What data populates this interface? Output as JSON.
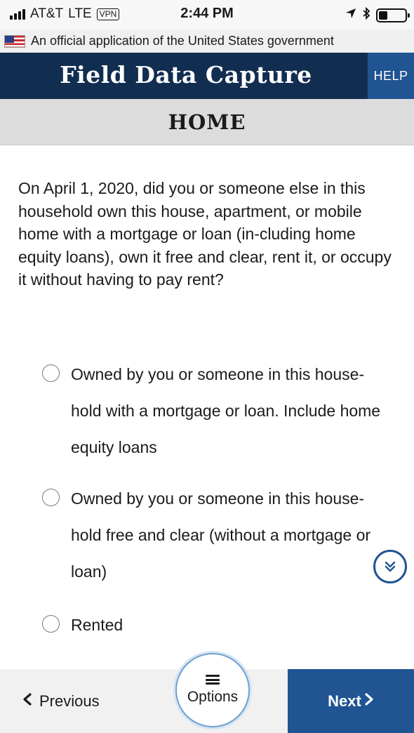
{
  "status_bar": {
    "carrier": "AT&T",
    "network": "LTE",
    "vpn": "VPN",
    "time": "2:44 PM",
    "location_icon": "location-arrow-icon",
    "bluetooth_icon": "bluetooth-icon",
    "battery_icon": "battery-icon"
  },
  "gov_banner": {
    "text": "An official application of the United States government",
    "flag_icon": "us-flag-icon"
  },
  "header": {
    "title": "Field Data Capture",
    "help_label": "HELP"
  },
  "section": {
    "title": "HOME"
  },
  "question": {
    "text": "On April 1, 2020, did you or someone else in this household own this house, apartment, or mobile home with a mortgage or loan (in-cluding home equity loans), own it free and clear, rent it, or occupy it without having to pay rent?"
  },
  "options": [
    {
      "label": "Owned by you or someone in this house-hold with a mortgage or loan. Include home equity loans",
      "selected": false
    },
    {
      "label": "Owned by you or someone in this house-hold free and clear (without a mortgage or loan)",
      "selected": false
    },
    {
      "label": "Rented",
      "selected": false
    }
  ],
  "footer": {
    "previous_label": "Previous",
    "options_label": "Options",
    "next_label": "Next"
  },
  "colors": {
    "header_bg": "#112e51",
    "accent_blue": "#205493",
    "section_bg": "#dcdcdc",
    "footer_bg": "#f1f1f1"
  }
}
